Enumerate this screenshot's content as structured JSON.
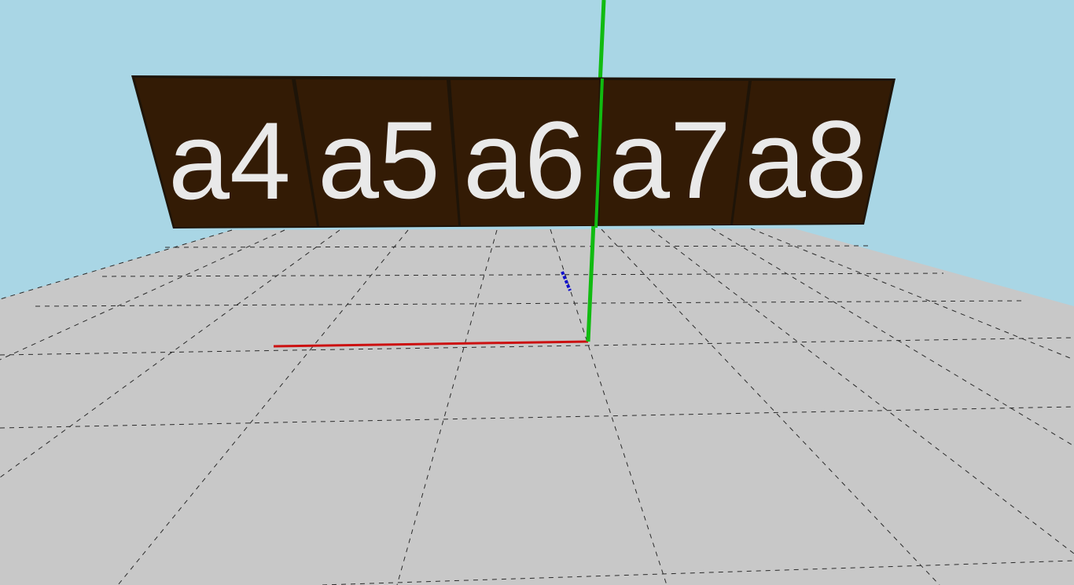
{
  "scene": {
    "colors": {
      "sky": "#a9d6e5",
      "ground": "#c8c8c8",
      "grid_line": "#2b2b2b",
      "board_fill": "#331b05",
      "board_edge": "#1e1408",
      "board_text": "#e9e9e9",
      "axis_x": "#cc1111",
      "axis_y": "#11bb11",
      "axis_z": "#1111cc"
    },
    "tiles": [
      {
        "label": "a4"
      },
      {
        "label": "a5"
      },
      {
        "label": "a6"
      },
      {
        "label": "a7"
      },
      {
        "label": "a8"
      }
    ]
  }
}
